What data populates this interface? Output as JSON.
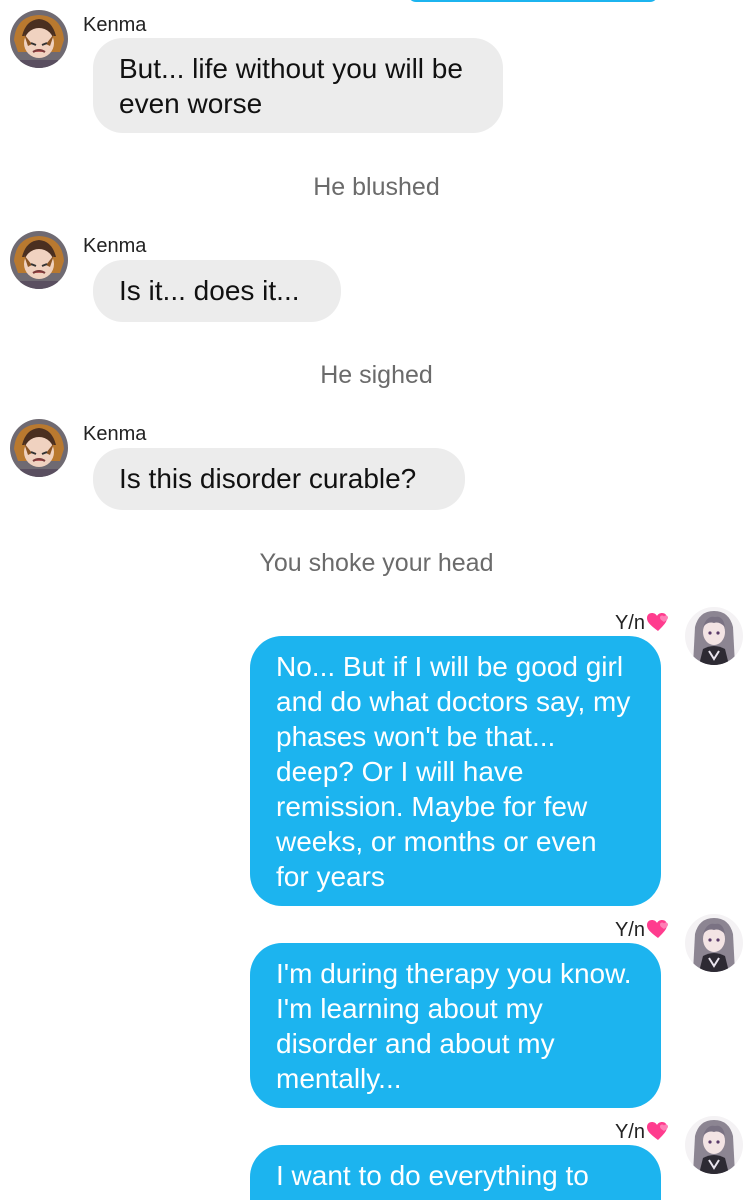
{
  "conversation": {
    "kenma_name": "Kenma",
    "yn_name": "Y/n",
    "messages": [
      "But... life without you will be even worse",
      "Is it... does it...",
      "Is this disorder curable?",
      "No... But if I will be good girl and do what doctors say, my phases won't be that... deep? Or I will have remission. Maybe for few weeks, or months or even for years",
      "I'm during therapy you know. I'm learning about my disorder and about my mentally...",
      "I want to do everything to"
    ],
    "narrations": [
      "He blushed",
      "He sighed",
      "You shoke your head"
    ]
  },
  "icons": {
    "kenma_avatar": "kenma-avatar",
    "yn_avatar": "yn-avatar",
    "name_decoration": "two-hearts-icon"
  },
  "colors": {
    "outgoing_bubble": "#1cb4ef",
    "incoming_bubble": "#ececec",
    "narration_text": "#6b6b6b"
  }
}
